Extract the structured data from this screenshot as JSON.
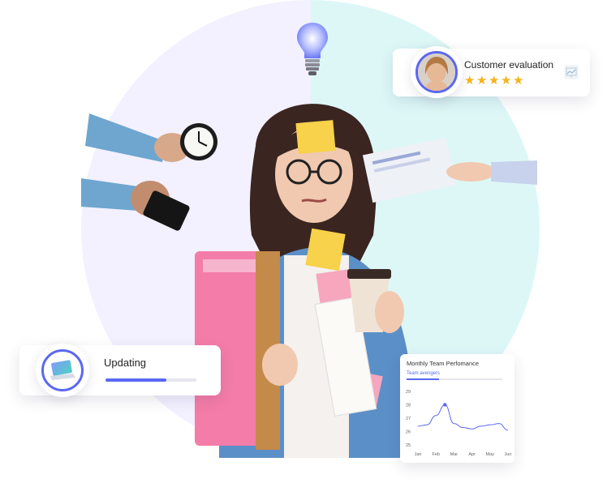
{
  "customer_card": {
    "title": "Customer evaluation",
    "rating": 5,
    "stars": [
      "★",
      "★",
      "★",
      "★",
      "★"
    ]
  },
  "updating_card": {
    "title": "Updating",
    "progress": 0.67
  },
  "chart_data": {
    "type": "line",
    "title": "Monthly Team Perfomance",
    "tab": "Team avengers",
    "categories": [
      "Jan",
      "Feb",
      "Mar",
      "Apr",
      "May",
      "Jun"
    ],
    "y_ticks": [
      25,
      26,
      27,
      28,
      29
    ],
    "ylim": [
      25,
      29
    ],
    "series": [
      {
        "x": [
          0,
          0.5,
          1,
          1.5,
          2,
          2.5,
          3,
          3.5,
          4,
          4.5,
          5
        ],
        "values": [
          26.4,
          26.5,
          27.2,
          28.0,
          26.6,
          26.3,
          26.2,
          26.4,
          26.5,
          26.6,
          26.1
        ]
      }
    ],
    "highlight_index": 3,
    "colors": {
      "line": "#5a67f2"
    }
  },
  "colors": {
    "accent": "#5a67f2",
    "star": "#f6b21a",
    "circle_left": "#f3f0ff",
    "circle_right": "#ddf7f7"
  }
}
